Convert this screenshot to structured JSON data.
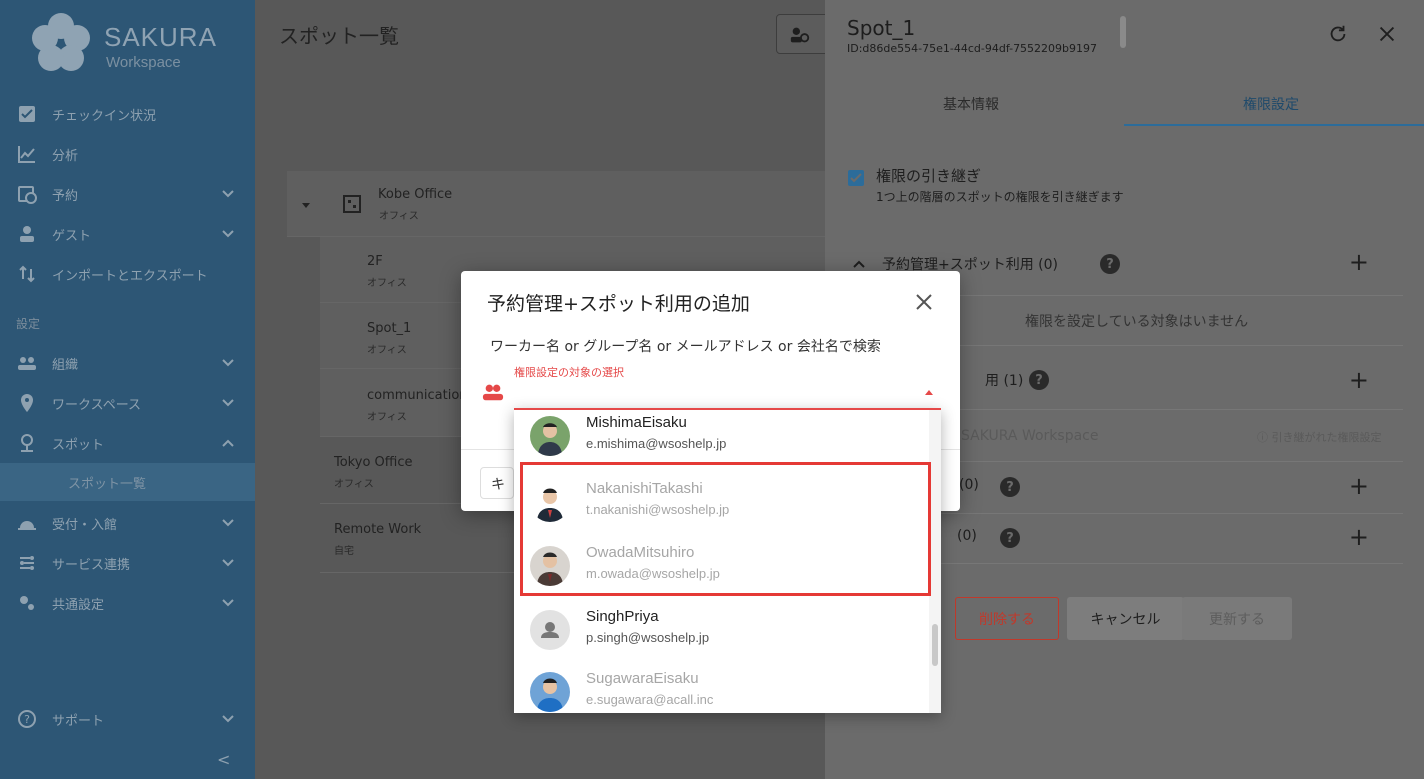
{
  "sidebar": {
    "brand": "SAKURA",
    "brand_sub": "Workspace",
    "items": [
      {
        "label": "チェックイン状況",
        "icon": "checkbox-icon"
      },
      {
        "label": "分析",
        "icon": "chart-line-icon"
      },
      {
        "label": "予約",
        "icon": "calendar-clock-icon"
      },
      {
        "label": "ゲスト",
        "icon": "guest-person-icon"
      },
      {
        "label": "インポートとエクスポート",
        "icon": "import-export-icon"
      }
    ],
    "section_label": "設定",
    "settings_items": [
      {
        "label": "組織",
        "icon": "people-icon"
      },
      {
        "label": "ワークスペース",
        "icon": "location-pin-icon"
      },
      {
        "label": "スポット",
        "icon": "person-pin-icon"
      }
    ],
    "sub_item": "スポット一覧",
    "more_items": [
      {
        "label": "受付・入館",
        "icon": "reception-bell-icon"
      },
      {
        "label": "サービス連携",
        "icon": "integration-icon"
      },
      {
        "label": "共通設定",
        "icon": "gears-icon"
      }
    ],
    "support": "サポート",
    "collapse": "<"
  },
  "main": {
    "title": "スポット一覧",
    "tree": [
      {
        "name": "Kobe Office",
        "type": "オフィス"
      },
      {
        "name": "2F",
        "type": "オフィス"
      },
      {
        "name": "Spot_1",
        "type": "オフィス"
      },
      {
        "name": "communication",
        "type": "オフィス"
      },
      {
        "name": "Tokyo Office",
        "type": "オフィス"
      },
      {
        "name": "Remote Work",
        "type": "自宅"
      }
    ]
  },
  "panel": {
    "title": "Spot_1",
    "id_text": "ID:d86de554-75e1-44cd-94df-7552209b9197",
    "tabs": [
      "基本情報",
      "権限設定"
    ],
    "inherit_label": "権限の引き継ぎ",
    "inherit_desc": "1つ上の階層のスポットの権限を引き継ぎます",
    "section1": "予約管理+スポット利用 (0)",
    "section1_empty": "権限を設定している対象はいません",
    "section2_tail": "用 (1)",
    "section2_row": "SAKURA Workspace",
    "section2_row_note": "引き継がれた権限設定",
    "section3_tail": "(0)",
    "section4_tail": "(0)",
    "delete_label": "削除する",
    "cancel_label": "キャンセル",
    "update_label": "更新する"
  },
  "modal": {
    "title": "予約管理+スポット利用の追加",
    "hint": "ワーカー名 or グループ名 or メールアドレス or 会社名で検索",
    "select_label": "権限設定の対象の選択",
    "cancel_fragment": "キャ"
  },
  "dropdown": {
    "items": [
      {
        "name": "MishimaEisaku",
        "email": "e.mishima@wsoshelp.jp"
      },
      {
        "name": "NakanishiTakashi",
        "email": "t.nakanishi@wsoshelp.jp"
      },
      {
        "name": "OwadaMitsuhiro",
        "email": "m.owada@wsoshelp.jp"
      },
      {
        "name": "SinghPriya",
        "email": "p.singh@wsoshelp.jp"
      },
      {
        "name": "SugawaraEisaku",
        "email": "e.sugawara@acall.inc"
      }
    ]
  },
  "colors": {
    "sidebar": "#2d5675",
    "accent_red": "#e53935",
    "tab_blue": "#2c6c9a"
  }
}
